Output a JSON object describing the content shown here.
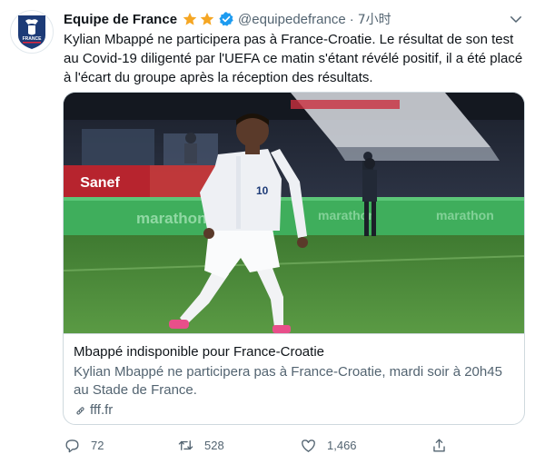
{
  "account": {
    "name": "Equipe de France",
    "handle": "@equipedefrance",
    "separator": "·",
    "time": "7小时",
    "avatar_text": "FRANCE"
  },
  "tweet": {
    "text": "Kylian Mbappé ne participera pas à France-Croatie. Le résultat de son test au Covid-19 diligenté par l'UEFA ce matin s'étant révélé positif, il a été placé à l'écart du groupe après la réception des résultats."
  },
  "card": {
    "title": "Mbappé indisponible pour France-Croatie",
    "description": "Kylian Mbappé ne participera pas à France-Croatie, mardi soir à 20h45 au Stade de France.",
    "domain": "fff.fr",
    "image_signage": {
      "left_board": "Sanef",
      "ad_board": "marathon",
      "player_number": "10"
    }
  },
  "actions": {
    "reply_count": "72",
    "retweet_count": "528",
    "like_count": "1,466"
  },
  "colors": {
    "star": "#f5a623",
    "verified": "#1d9bf0",
    "secondary_text": "#536471",
    "border": "#cfd9de",
    "pitch": "#4d8a3a",
    "ad_board": "#3fae5c"
  },
  "icons": [
    "star-icon",
    "verified-badge-icon",
    "more-icon",
    "link-icon",
    "reply-icon",
    "retweet-icon",
    "like-icon",
    "share-icon"
  ]
}
